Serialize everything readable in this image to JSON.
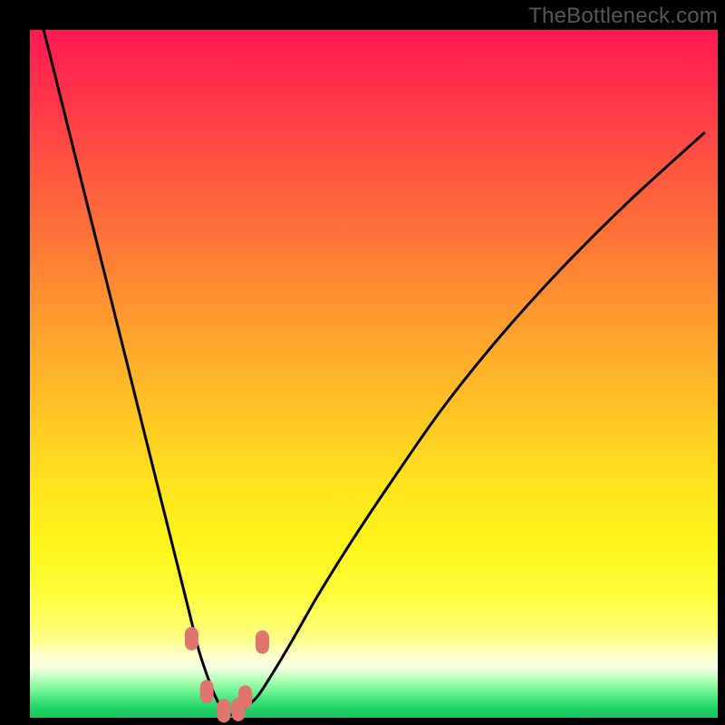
{
  "watermark": "TheBottleneck.com",
  "colors": {
    "frame": "#000000",
    "curve": "#000000",
    "marker": "#e0756f"
  },
  "chart_data": {
    "type": "line",
    "title": "",
    "xlabel": "",
    "ylabel": "",
    "xlim": [
      0,
      100
    ],
    "ylim": [
      0,
      100
    ],
    "grid": false,
    "series": [
      {
        "name": "bottleneck-curve",
        "x": [
          2,
          5,
          8,
          11,
          14,
          17,
          20,
          21.5,
          23,
          24.5,
          26,
          27,
          28,
          29,
          30,
          31,
          33,
          35,
          38,
          42,
          47,
          53,
          60,
          68,
          77,
          87,
          98
        ],
        "y": [
          100,
          88,
          76,
          64,
          52,
          40,
          28,
          22,
          16,
          10,
          5.5,
          3,
          1.3,
          0.5,
          0.5,
          1.2,
          3,
          6,
          11,
          18,
          26,
          35,
          45,
          55,
          65,
          75,
          85
        ]
      }
    ],
    "markers": [
      {
        "x": 23.5,
        "y": 11.5
      },
      {
        "x": 25.7,
        "y": 3.8
      },
      {
        "x": 28.2,
        "y": 1.0
      },
      {
        "x": 30.3,
        "y": 1.2
      },
      {
        "x": 31.3,
        "y": 3.0
      },
      {
        "x": 33.8,
        "y": 11.0
      }
    ]
  }
}
